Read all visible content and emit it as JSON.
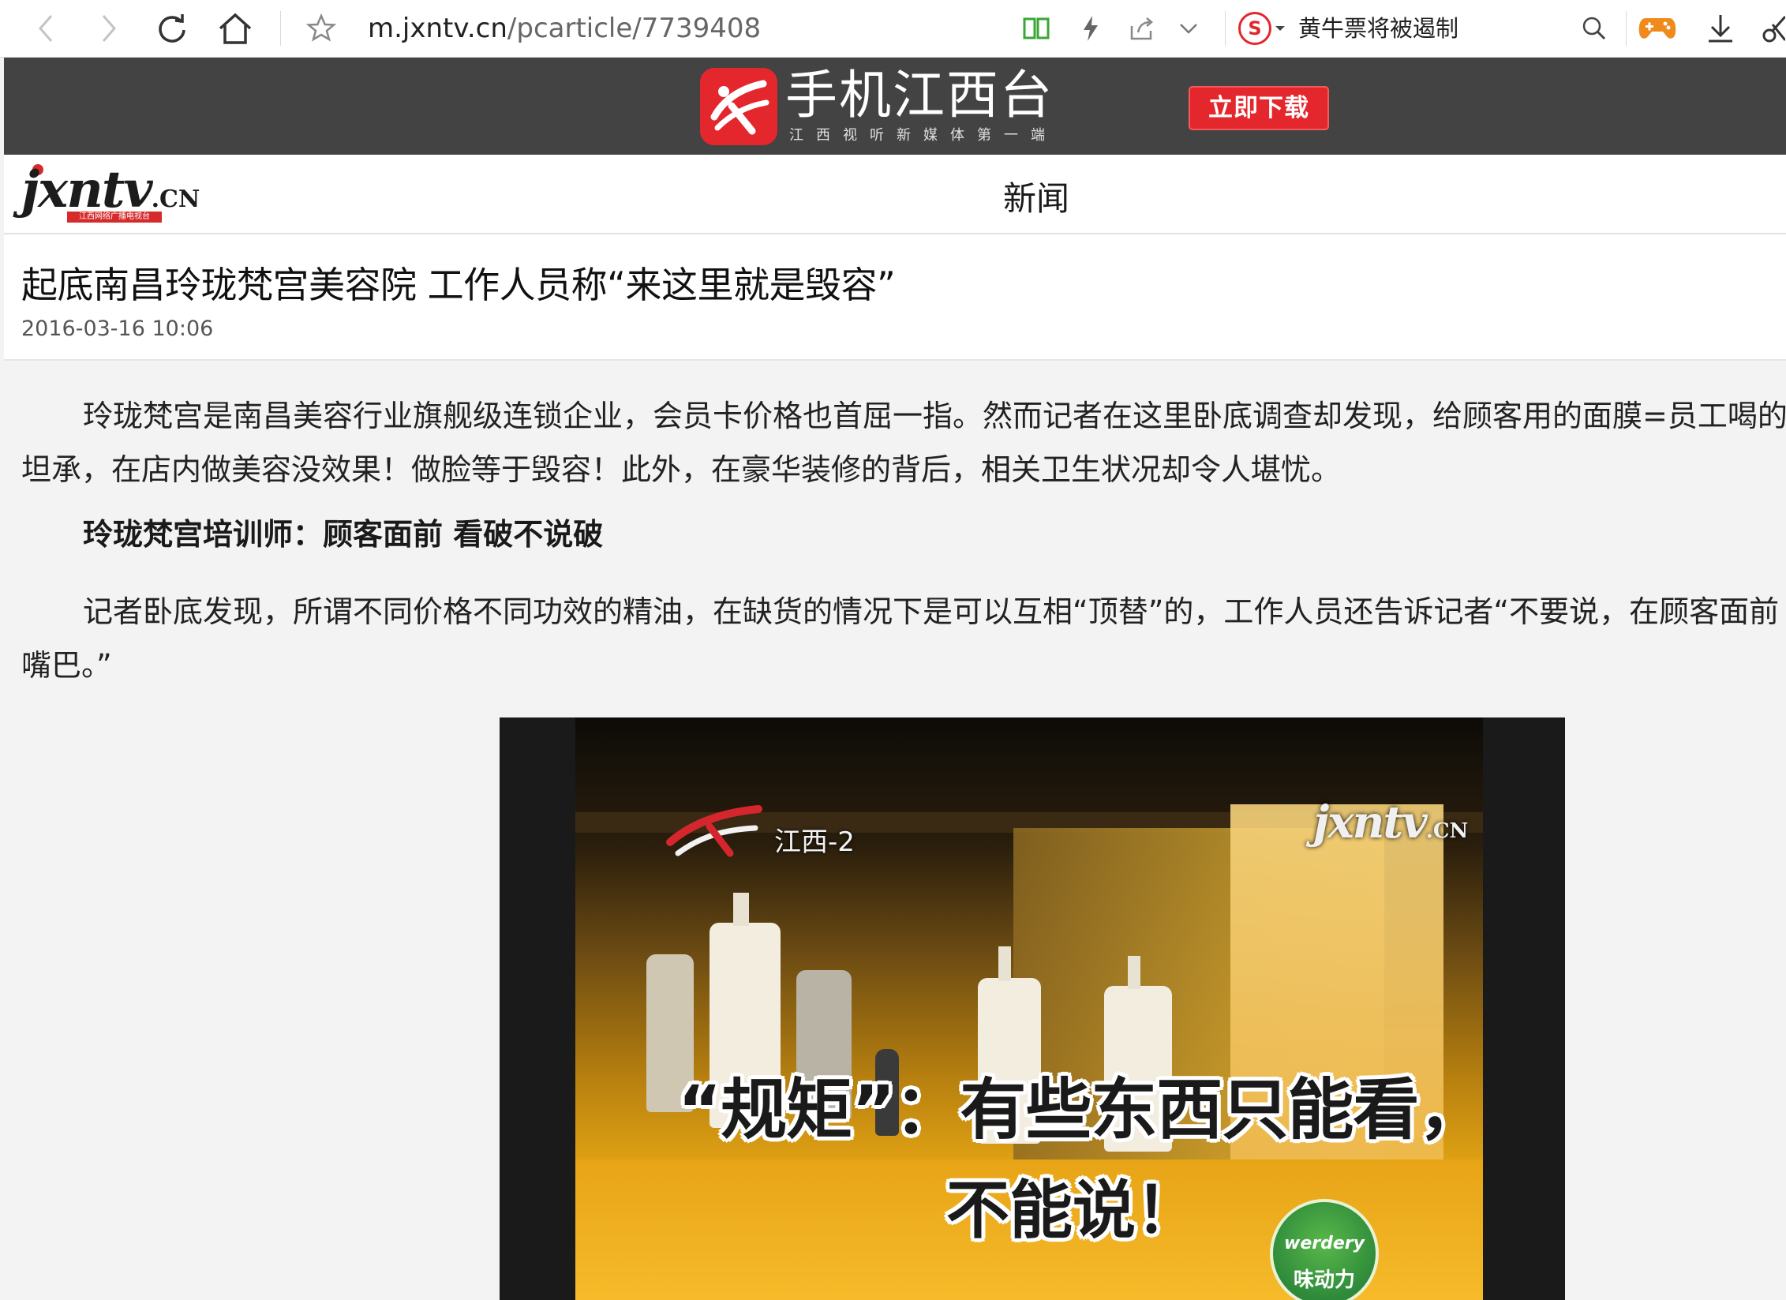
{
  "browser": {
    "url_host": "m.jxntv.cn",
    "url_path": "/pcarticle/7739408",
    "search_engine_badge": "S",
    "news_ticker": "黄牛票将被遏制"
  },
  "banner": {
    "app_name": "手机江西台",
    "tagline": "江西视听新媒体第一端",
    "download_label": "立即下载"
  },
  "site": {
    "logo_text": "jxntv",
    "logo_suffix": ".CN",
    "logo_sub": "江西网络广播电视台",
    "nav_item": "新闻"
  },
  "article": {
    "title": "起底南昌玲珑梵宫美容院 工作人员称“来这里就是毁容”",
    "date": "2016-03-16 10:06",
    "p1_line1": "玲珑梵宫是南昌美容行业旗舰级连锁企业，会员卡价格也首屈一指。然而记者在这里卧底调查却发现，给顾客用的面膜=员工喝的",
    "p1_line2": "坦承，在店内做美容没效果！做脸等于毁容！此外，在豪华装修的背后，相关卫生状况却令人堪忧。",
    "subhead": "玲珑梵宫培训师：顾客面前 看破不说破",
    "p2_line1": "记者卧底发现，所谓不同价格不同功效的精油，在缺货的情况下是可以互相“顶替”的，工作人员还告诉记者“不要说，在顾客面前",
    "p2_line2": "嘴巴。”"
  },
  "video": {
    "channel": "江西-2",
    "watermark": "jxntv",
    "watermark_suffix": ".CN",
    "subtitle_line1": "“规矩”：有些东西只能看，",
    "subtitle_line2": "不能说！",
    "sponsor_top": "werdery",
    "sponsor_bottom": "味动力"
  }
}
